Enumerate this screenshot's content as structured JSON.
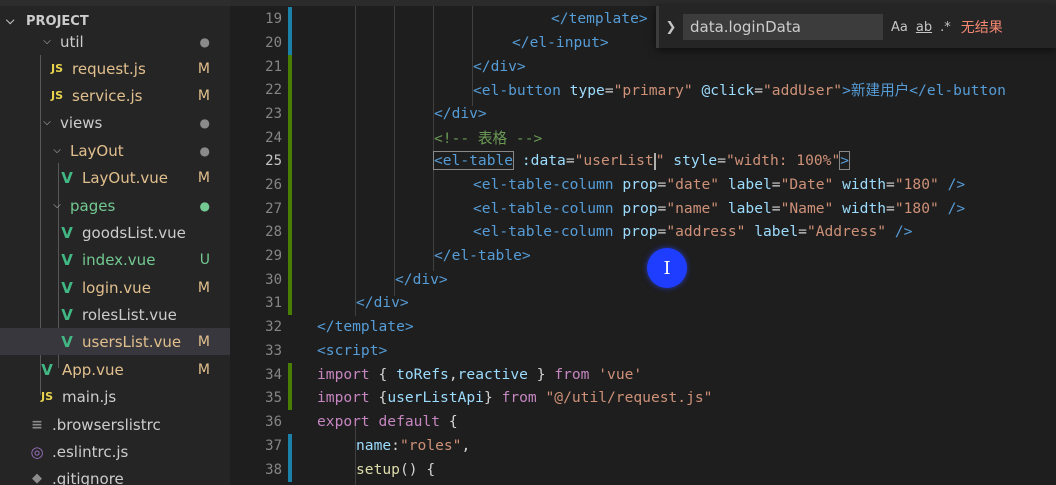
{
  "explorer": {
    "section_title": "PROJECT",
    "items": [
      {
        "label": "util",
        "badge": "●",
        "icon": "folder"
      },
      {
        "label": "request.js",
        "badge": "M",
        "icon": "js"
      },
      {
        "label": "service.js",
        "badge": "M",
        "icon": "js"
      },
      {
        "label": "views",
        "badge": "●",
        "icon": "folder"
      },
      {
        "label": "LayOut",
        "badge": "●",
        "icon": "folder"
      },
      {
        "label": "LayOut.vue",
        "badge": "M",
        "icon": "vue"
      },
      {
        "label": "pages",
        "badge": "●",
        "icon": "folder"
      },
      {
        "label": "goodsList.vue",
        "badge": "",
        "icon": "vue"
      },
      {
        "label": "index.vue",
        "badge": "U",
        "icon": "vue"
      },
      {
        "label": "login.vue",
        "badge": "M",
        "icon": "vue"
      },
      {
        "label": "rolesList.vue",
        "badge": "",
        "icon": "vue"
      },
      {
        "label": "usersList.vue",
        "badge": "M",
        "icon": "vue"
      },
      {
        "label": "App.vue",
        "badge": "M",
        "icon": "vue"
      },
      {
        "label": "main.js",
        "badge": "",
        "icon": "js"
      },
      {
        "label": ".browserslistrc",
        "badge": "",
        "icon": "text"
      },
      {
        "label": ".eslintrc.js",
        "badge": "",
        "icon": "eslint"
      },
      {
        "label": ".gitignore",
        "badge": "",
        "icon": "git"
      }
    ],
    "js_icon_text": "JS"
  },
  "find": {
    "query": "data.loginData",
    "result": "无结果",
    "opt_case": "Aa",
    "opt_word": "ab",
    "opt_regex": ".*"
  },
  "editor": {
    "lines": [
      {
        "n": "19",
        "t": [
          "</template>"
        ]
      },
      {
        "n": "20",
        "t": [
          "</el-input>"
        ]
      },
      {
        "n": "21",
        "t": [
          "</div>"
        ]
      },
      {
        "n": "22",
        "t": [
          "<el-button",
          "type",
          "=",
          "\"primary\"",
          "@click",
          "=",
          "\"addUser\"",
          ">新建用户</el-button"
        ]
      },
      {
        "n": "23",
        "t": [
          "</div>"
        ]
      },
      {
        "n": "24",
        "t": [
          "<!-- 表格 -->"
        ]
      },
      {
        "n": "25",
        "t": [
          "<el-table",
          ":data",
          "=",
          "\"userList",
          "\"",
          "style",
          "=",
          "\"width: 100%\"",
          ">"
        ]
      },
      {
        "n": "26",
        "t": [
          "<el-table-column",
          "prop",
          "=",
          "\"date\"",
          "label",
          "=",
          "\"Date\"",
          "width",
          "=",
          "\"180\"",
          "/>"
        ]
      },
      {
        "n": "27",
        "t": [
          "<el-table-column",
          "prop",
          "=",
          "\"name\"",
          "label",
          "=",
          "\"Name\"",
          "width",
          "=",
          "\"180\"",
          "/>"
        ]
      },
      {
        "n": "28",
        "t": [
          "<el-table-column",
          "prop",
          "=",
          "\"address\"",
          "label",
          "=",
          "\"Address\"",
          "/>"
        ]
      },
      {
        "n": "29",
        "t": [
          "</el-table>"
        ]
      },
      {
        "n": "30",
        "t": [
          "</div>"
        ]
      },
      {
        "n": "31",
        "t": [
          "</div>"
        ]
      },
      {
        "n": "32",
        "t": [
          "</template>"
        ]
      },
      {
        "n": "33",
        "t": [
          "<script>"
        ]
      },
      {
        "n": "34",
        "t": [
          "import",
          "{",
          "toRefs",
          ",",
          "reactive",
          "}",
          "from",
          "'vue'"
        ]
      },
      {
        "n": "35",
        "t": [
          "import",
          "{",
          "userListApi",
          "}",
          "from",
          "\"@/util/request.js\""
        ]
      },
      {
        "n": "36",
        "t": [
          "export",
          "default",
          "{"
        ]
      },
      {
        "n": "37",
        "t": [
          "name",
          ":",
          "\"roles\"",
          ","
        ]
      },
      {
        "n": "38",
        "t": [
          "setup",
          "()",
          "{"
        ]
      }
    ]
  },
  "pointer_glyph": "I",
  "colors": {
    "accent": "#1b81a8",
    "added": "#487e02",
    "modified": "#e2c08d",
    "untracked": "#73c991",
    "no_result": "#f48771"
  }
}
